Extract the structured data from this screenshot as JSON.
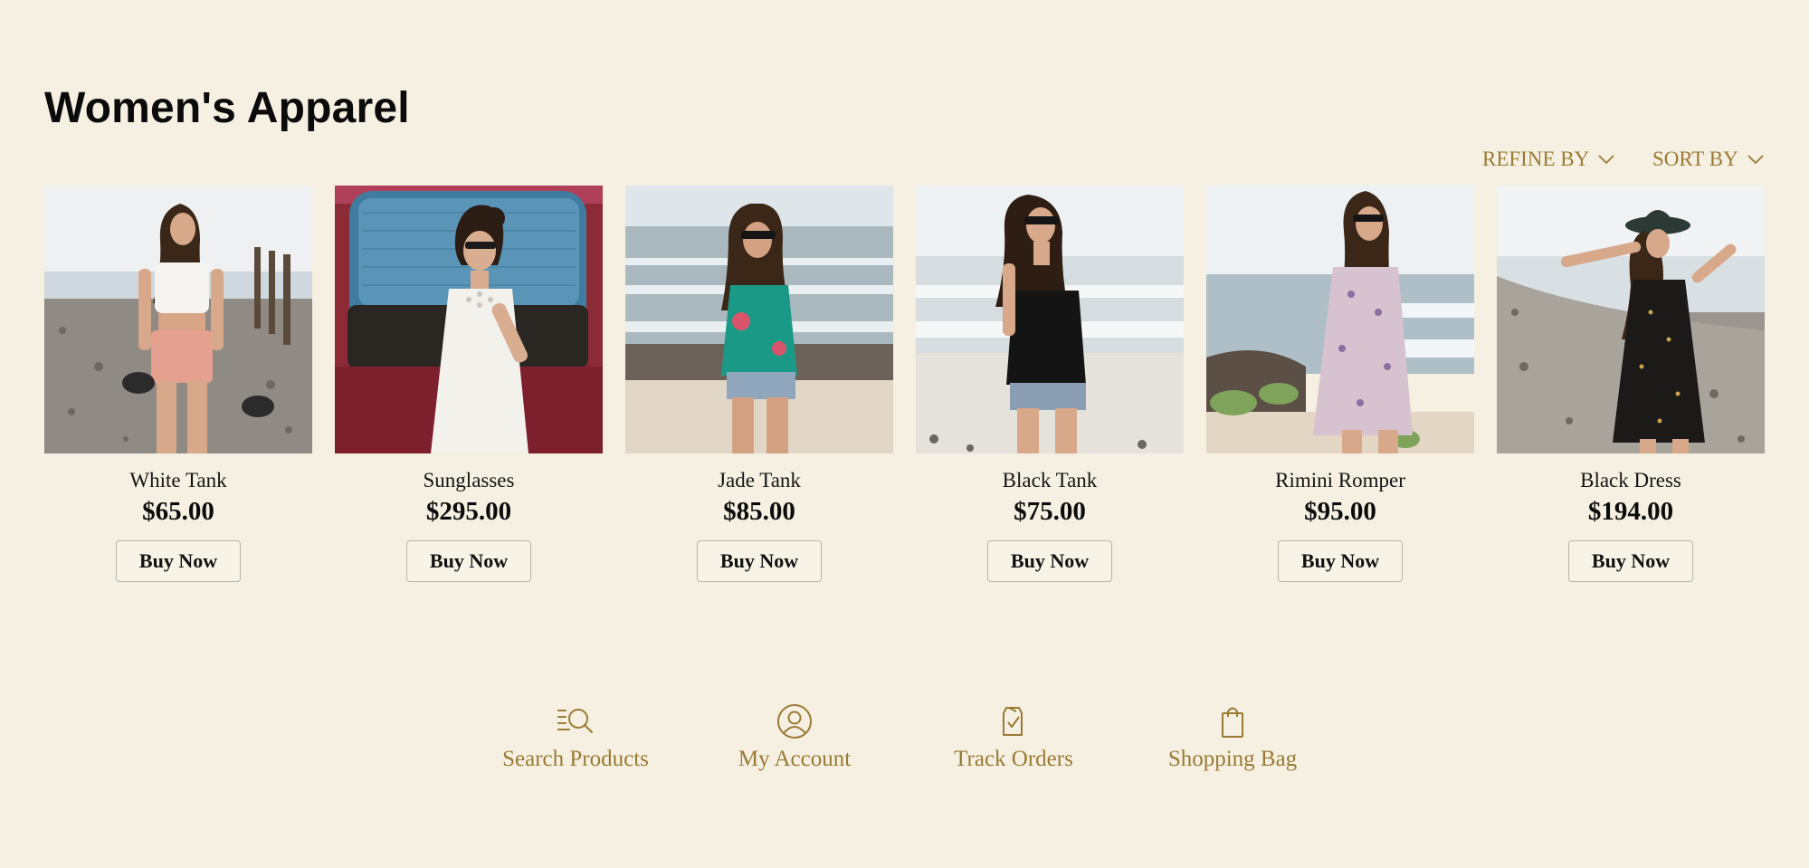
{
  "page": {
    "title": "Women's Apparel"
  },
  "filters": {
    "refine_label": "REFINE BY",
    "sort_label": "SORT BY"
  },
  "products": [
    {
      "name": "White Tank",
      "price": "$65.00",
      "button": "Buy Now"
    },
    {
      "name": "Sunglasses",
      "price": "$295.00",
      "button": "Buy Now"
    },
    {
      "name": "Jade Tank",
      "price": "$85.00",
      "button": "Buy Now"
    },
    {
      "name": "Black Tank",
      "price": "$75.00",
      "button": "Buy Now"
    },
    {
      "name": "Rimini Romper",
      "price": "$95.00",
      "button": "Buy Now"
    },
    {
      "name": "Black Dress",
      "price": "$194.00",
      "button": "Buy Now"
    }
  ],
  "bottom_nav": [
    {
      "label": "Search Products",
      "icon": "search-list-icon"
    },
    {
      "label": "My Account",
      "icon": "user-circle-icon"
    },
    {
      "label": "Track Orders",
      "icon": "clipboard-check-icon"
    },
    {
      "label": "Shopping Bag",
      "icon": "shopping-bag-icon"
    }
  ],
  "colors": {
    "background": "#f5f0e1",
    "accent_gold": "#9a7a35",
    "text_dark": "#111111",
    "button_border": "#b9b5ab"
  }
}
